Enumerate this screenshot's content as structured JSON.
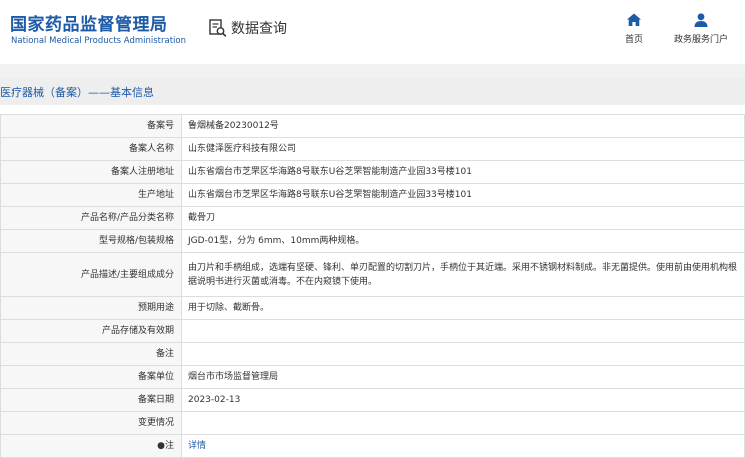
{
  "header": {
    "logo_cn": "国家药品监督管理局",
    "logo_en": "National Medical Products Administration",
    "query_label": "数据查询",
    "nav": [
      {
        "label": "首页",
        "icon": "home-icon"
      },
      {
        "label": "政务服务门户",
        "icon": "user-icon"
      }
    ]
  },
  "section_title": "医疗器械（备案）——基本信息",
  "rows": [
    {
      "label": "备案号",
      "value": "鲁烟械备20230012号"
    },
    {
      "label": "备案人名称",
      "value": "山东健泽医疗科技有限公司"
    },
    {
      "label": "备案人注册地址",
      "value": "山东省烟台市芝罘区华海路8号联东U谷芝罘智能制造产业园33号楼101"
    },
    {
      "label": "生产地址",
      "value": "山东省烟台市芝罘区华海路8号联东U谷芝罘智能制造产业园33号楼101"
    },
    {
      "label": "产品名称/产品分类名称",
      "value": "截骨刀"
    },
    {
      "label": "型号规格/包装规格",
      "value": "JGD-01型，分为 6mm、10mm两种规格。"
    },
    {
      "label": "产品描述/主要组成成分",
      "value": "由刀片和手柄组成，选端有坚硬、锋利、单刃配置的切割刀片，手柄位于其近端。采用不锈钢材料制成。非无菌提供。使用前由使用机构根据说明书进行灭菌或消毒。不在内窥镜下使用。"
    },
    {
      "label": "预期用途",
      "value": "用于切除、截断骨。"
    },
    {
      "label": "产品存储及有效期",
      "value": ""
    },
    {
      "label": "备注",
      "value": ""
    },
    {
      "label": "备案单位",
      "value": "烟台市市场监督管理局"
    },
    {
      "label": "备案日期",
      "value": "2023-02-13"
    },
    {
      "label": "变更情况",
      "value": ""
    },
    {
      "label": "●注",
      "value": "详情"
    }
  ],
  "colors": {
    "brand_blue": "#1d5aa8",
    "label_bg": "#f7f7f7",
    "border": "#dddddd"
  }
}
